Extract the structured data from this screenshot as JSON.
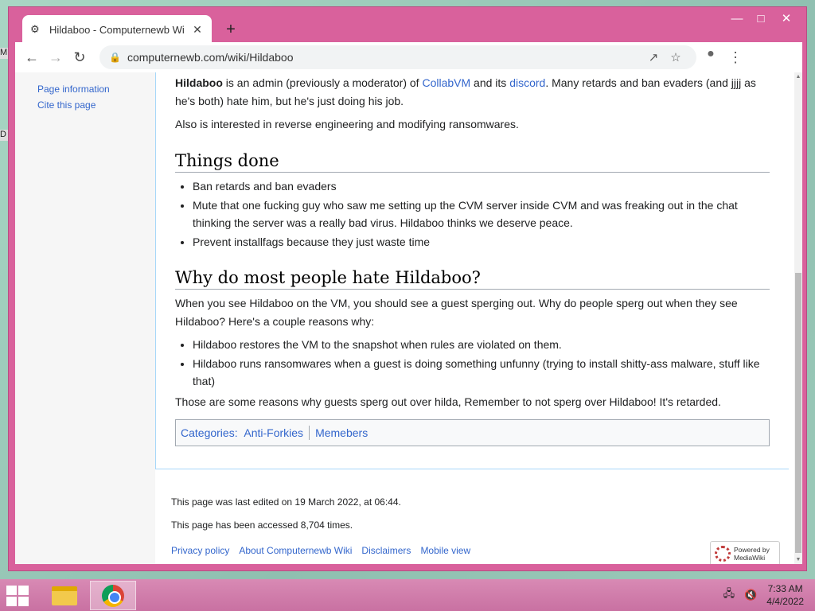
{
  "browser": {
    "tab_title": "Hildaboo - Computernewb Wiki",
    "url": "computernewb.com/wiki/Hildaboo"
  },
  "left_panel": {
    "links": [
      "Page information",
      "Cite this page"
    ]
  },
  "article": {
    "intro": {
      "bold": "Hildaboo",
      "t1": " is an admin (previously a moderator) of ",
      "link1": "CollabVM",
      "t2": " and its ",
      "link2": "discord",
      "t3": ". Many retards and ban evaders (and jjjj as he's both) hate him, but he's just doing his job."
    },
    "intro2": "Also is interested in reverse engineering and modifying ransomwares.",
    "section1": {
      "heading": "Things done",
      "items": [
        "Ban retards and ban evaders",
        "Mute that one fucking guy who saw me setting up the CVM server inside CVM and was freaking out in the chat thinking the server was a really bad virus. Hildaboo thinks we deserve peace.",
        "Prevent installfags because they just waste time"
      ]
    },
    "section2": {
      "heading": "Why do most people hate Hildaboo?",
      "intro": "When you see Hildaboo on the VM, you should see a guest sperging out. Why do people sperg out when they see Hildaboo? Here's a couple reasons why:",
      "items": [
        "Hildaboo restores the VM to the snapshot when rules are violated on them.",
        "Hildaboo runs ransomwares when a guest is doing something unfunny (trying to install shitty-ass malware, stuff like that)"
      ],
      "outro": "Those are some reasons why guests sperg out over hilda, Remember to not sperg over Hildaboo! It's retarded."
    },
    "categories": {
      "label": "Categories",
      "items": [
        "Anti-Forkies",
        "Memebers"
      ]
    }
  },
  "footer": {
    "last_edited": "This page was last edited on 19 March 2022, at 06:44.",
    "accessed": "This page has been accessed 8,704 times.",
    "links": [
      "Privacy policy",
      "About Computernewb Wiki",
      "Disclaimers",
      "Mobile view"
    ],
    "powered_by": "Powered by",
    "powered_name": "MediaWiki"
  },
  "taskbar": {
    "time": "7:33 AM",
    "date": "4/4/2022"
  },
  "icons": {
    "tab_favicon": "favicon-icon",
    "back": "back-arrow-icon",
    "forward": "forward-arrow-icon",
    "reload": "reload-icon",
    "lock": "lock-icon",
    "share": "share-icon",
    "bookmark": "star-icon",
    "profile": "profile-icon",
    "menu": "kebab-menu-icon"
  },
  "colors": {
    "window_frame": "#d9619c",
    "link": "#3366cc",
    "taskbar": "#c971a2"
  }
}
